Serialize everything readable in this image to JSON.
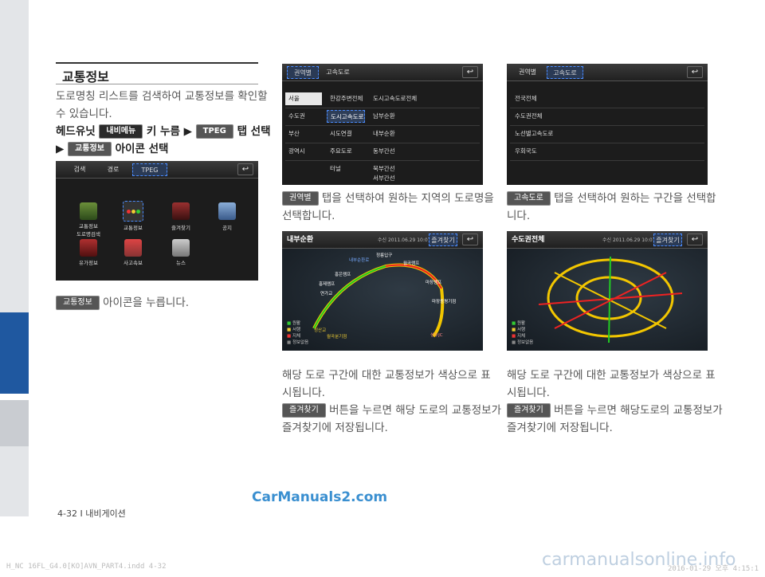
{
  "section_title": "교통정보",
  "intro_line1": "도로명칭 리스트를 검색하여 교통정보를 확인할",
  "intro_line2": "수 있습니다.",
  "instr1_a": "헤드유닛",
  "instr1_btn": "내비메뉴",
  "instr1_b": "키 누름 ▶",
  "instr1_btn2": "TPEG",
  "instr1_c": "탭 선택",
  "instr2_a": "▶",
  "instr2_btn": "교통정보",
  "instr2_b": "아이콘 선택",
  "screen1": {
    "tabs": [
      "검색",
      "경로",
      "TPEG"
    ],
    "icons": [
      "교통정보\n도로명검색",
      "교통정보",
      "즐겨찾기",
      "공지",
      "유가정보",
      "사고속보",
      "뉴스"
    ]
  },
  "caption1_btn": "교통정보",
  "caption1": "아이콘을 누릅니다.",
  "screen2": {
    "tabs": [
      "권역별",
      "고속도로"
    ],
    "col1": [
      "서울",
      "수도권",
      "부산",
      "광역시"
    ],
    "col2": [
      "한강주변전체",
      "도시고속도로",
      "시도연결",
      "주요도로",
      "터널"
    ],
    "col3": [
      "도시고속도로전체",
      "남부순환",
      "내부순환",
      "동부간선",
      "북부간선",
      "서부간선"
    ]
  },
  "caption2_btn": "권역별",
  "caption2_line1": "탭을 선택하여 원하는 지역의 도로명을",
  "caption2_line2": "선택합니다.",
  "screen3": {
    "tabs": [
      "권역별",
      "고속도로"
    ],
    "list": [
      "전국전체",
      "수도권전체",
      "노선별고속도로",
      "우회국도"
    ]
  },
  "caption3_btn": "고속도로",
  "caption3_line1": "탭을 선택하여 원하는 구간을 선택합",
  "caption3_line2": "니다.",
  "map1": {
    "title": "내부순환",
    "time": "수신 2011.06.29 10:07",
    "fav": "즐겨찾기",
    "labels": [
      "정릉입구",
      "내부순환로",
      "월곡램프",
      "홍은램프",
      "홍제램프",
      "연가교",
      "마장램프",
      "마장동평기점",
      "성수JC",
      "성산교",
      "월곡분기점"
    ],
    "legend": [
      "원활",
      "서행",
      "지체",
      "정보없음"
    ]
  },
  "map2": {
    "title": "수도권전체",
    "time": "수신 2011.06.29 10:07",
    "fav": "즐겨찾기",
    "legend": [
      "원활",
      "서행",
      "지체",
      "정보없음"
    ]
  },
  "caption4_line1": "해당 도로 구간에 대한 교통정보가 색상으로 표",
  "caption4_line2": "시됩니다.",
  "caption4_btn": "즐겨찾기",
  "caption4_line3": "버튼을 누르면 해당 도로의 교통정보가",
  "caption4_line4": "즐겨찾기에 저장됩니다.",
  "caption5_line1": "해당 도로 구간에 대한 교통정보가 색상으로 표",
  "caption5_line2": "시됩니다.",
  "caption5_btn": "즐겨찾기",
  "caption5_line3": "버튼을 누르면 해당도로의 교통정보가",
  "caption5_line4": "즐겨찾기에 저장됩니다.",
  "watermark": "CarManuals2.com",
  "page_footer": "4-32 I 내비게이션",
  "file_footer": "H_NC 16FL_G4.0[KO]AVN_PART4.indd   4-32",
  "date_footer": "2016-01-29   오후 4:15:1",
  "site_watermark": "carmanualsonline.info"
}
